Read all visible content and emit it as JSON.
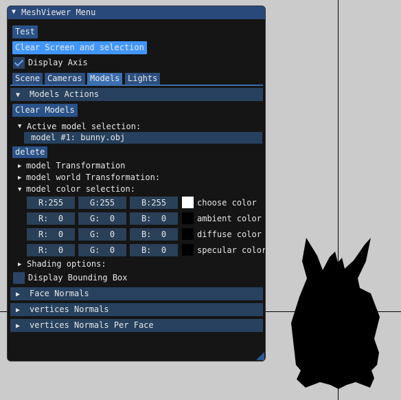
{
  "window": {
    "title": "MeshViewer Menu"
  },
  "buttons": {
    "test": "Test",
    "clear_screen": "Clear Screen and selection",
    "clear_models": "Clear Models",
    "delete": "delete"
  },
  "display_axis": {
    "label": "Display Axis",
    "checked": true
  },
  "tabs": [
    "Scene",
    "Cameras",
    "Models",
    "Lights"
  ],
  "selected_tab": "Models",
  "models_actions": {
    "header": "Models Actions"
  },
  "active_selection": {
    "label": "Active model selection:",
    "value": "model #1: bunny.obj"
  },
  "tree": {
    "model_transformation": "model Transformation",
    "model_world_transformation": "model world Transformation:",
    "model_color_selection": "model color selection:",
    "shading_options": "Shading options:"
  },
  "colors": [
    {
      "r": "R:255",
      "g": "G:255",
      "b": "B:255",
      "swatch": "#ffffff",
      "label": "choose color"
    },
    {
      "r": "R:  0",
      "g": "G:  0",
      "b": "B:  0",
      "swatch": "#000000",
      "label": "ambient color"
    },
    {
      "r": "R:  0",
      "g": "G:  0",
      "b": "B:  0",
      "swatch": "#000000",
      "label": "diffuse color"
    },
    {
      "r": "R:  0",
      "g": "G:  0",
      "b": "B:  0",
      "swatch": "#000000",
      "label": "specular color"
    }
  ],
  "bounding_box": {
    "label": "Display Bounding Box",
    "checked": false
  },
  "sections": [
    "Face Normals",
    "vertices Normals",
    "vertices Normals Per Face"
  ],
  "palette": {
    "background": "#cbcbcb",
    "panel": "#151515",
    "accent": "#4296fa",
    "button": "#2a5288",
    "mesh": "#000000"
  }
}
